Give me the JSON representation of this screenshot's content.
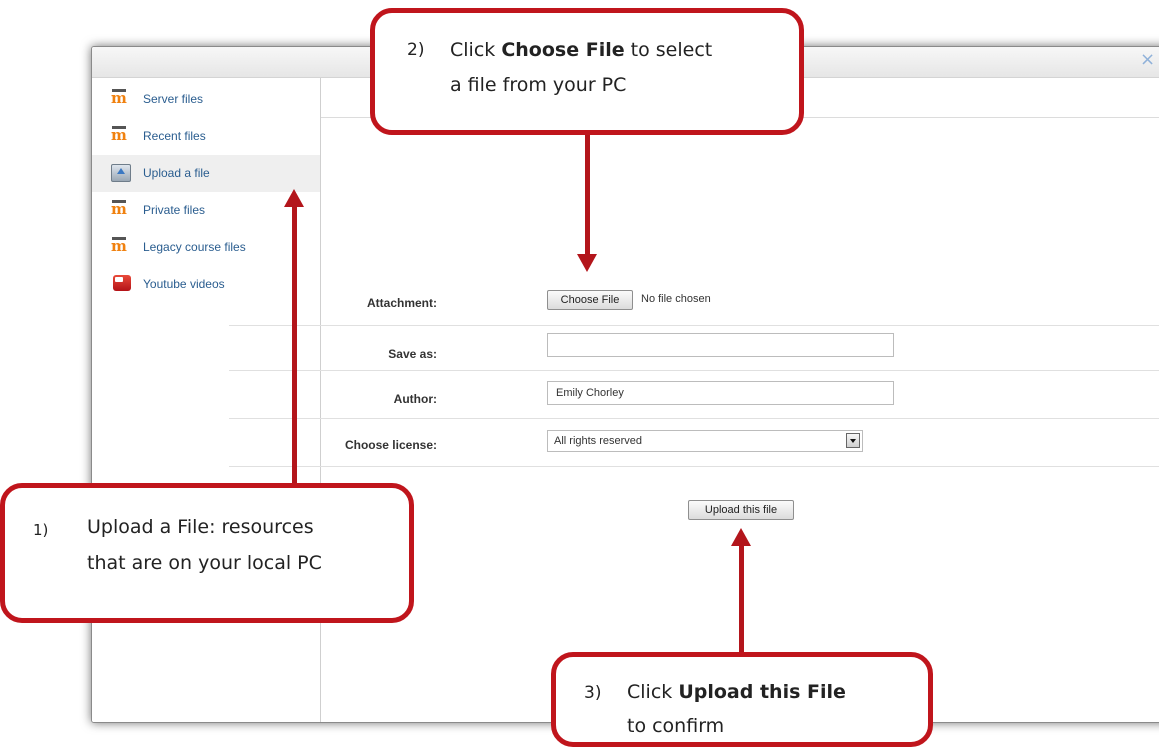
{
  "dialog": {
    "close_symbol": "×"
  },
  "sidebar": {
    "items": [
      {
        "label": "Server files",
        "icon": "moodle-icon"
      },
      {
        "label": "Recent files",
        "icon": "moodle-icon"
      },
      {
        "label": "Upload a file",
        "icon": "upload-icon",
        "selected": true
      },
      {
        "label": "Private files",
        "icon": "moodle-icon"
      },
      {
        "label": "Legacy course files",
        "icon": "moodle-icon"
      },
      {
        "label": "Youtube videos",
        "icon": "youtube-icon"
      }
    ]
  },
  "toolbar": {
    "view_icons": [
      "▦",
      "≡",
      "☰"
    ]
  },
  "form": {
    "attachment_label": "Attachment:",
    "choose_file_button": "Choose File",
    "no_file_text": "No file chosen",
    "save_as_label": "Save as:",
    "save_as_value": "",
    "author_label": "Author:",
    "author_value": "Emily Chorley",
    "license_label": "Choose license:",
    "license_value": "All rights reserved",
    "upload_button": "Upload this file"
  },
  "annotations": {
    "step1": {
      "number": "1)",
      "line1": "Upload a File: resources",
      "line2": "that are on your local PC"
    },
    "step2": {
      "number": "2)",
      "prefix": "Click ",
      "bold": "Choose File",
      "suffix": " to select",
      "line2": "a file from your PC"
    },
    "step3": {
      "number": "3)",
      "prefix": "Click ",
      "bold": "Upload this File",
      "line2": "to confirm"
    },
    "accent_color": "#c0151c"
  }
}
